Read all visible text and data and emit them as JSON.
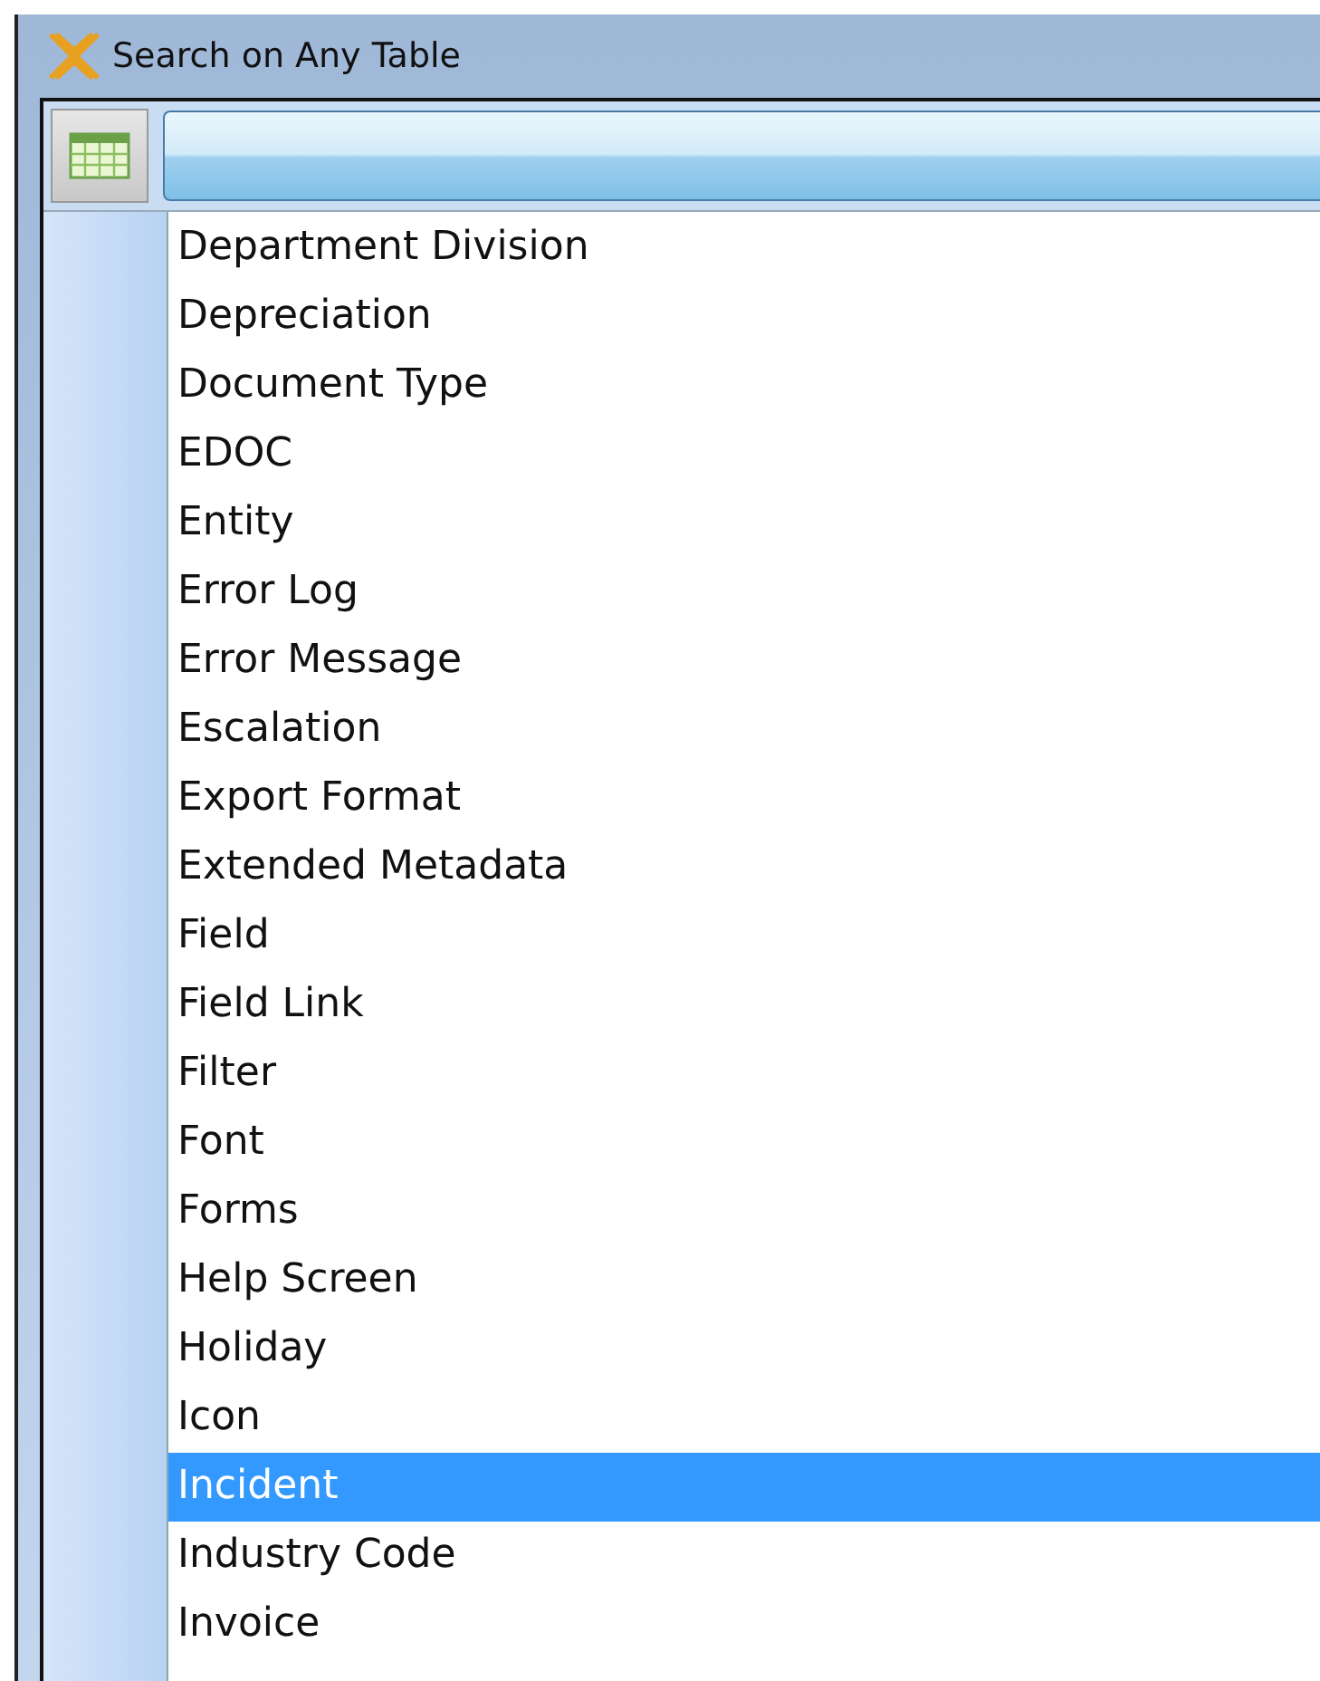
{
  "window": {
    "title": "Search on Any Table"
  },
  "tables": [
    {
      "label": "Department Division",
      "selected": false
    },
    {
      "label": "Depreciation",
      "selected": false
    },
    {
      "label": "Document Type",
      "selected": false
    },
    {
      "label": "EDOC",
      "selected": false
    },
    {
      "label": "Entity",
      "selected": false
    },
    {
      "label": "Error Log",
      "selected": false
    },
    {
      "label": "Error Message",
      "selected": false
    },
    {
      "label": "Escalation",
      "selected": false
    },
    {
      "label": "Export Format",
      "selected": false
    },
    {
      "label": "Extended Metadata",
      "selected": false
    },
    {
      "label": "Field",
      "selected": false
    },
    {
      "label": "Field Link",
      "selected": false
    },
    {
      "label": "Filter",
      "selected": false
    },
    {
      "label": "Font",
      "selected": false
    },
    {
      "label": "Forms",
      "selected": false
    },
    {
      "label": "Help Screen",
      "selected": false
    },
    {
      "label": "Holiday",
      "selected": false
    },
    {
      "label": "Icon",
      "selected": false
    },
    {
      "label": "Incident",
      "selected": true
    },
    {
      "label": "Industry Code",
      "selected": false
    },
    {
      "label": "Invoice",
      "selected": false
    }
  ]
}
